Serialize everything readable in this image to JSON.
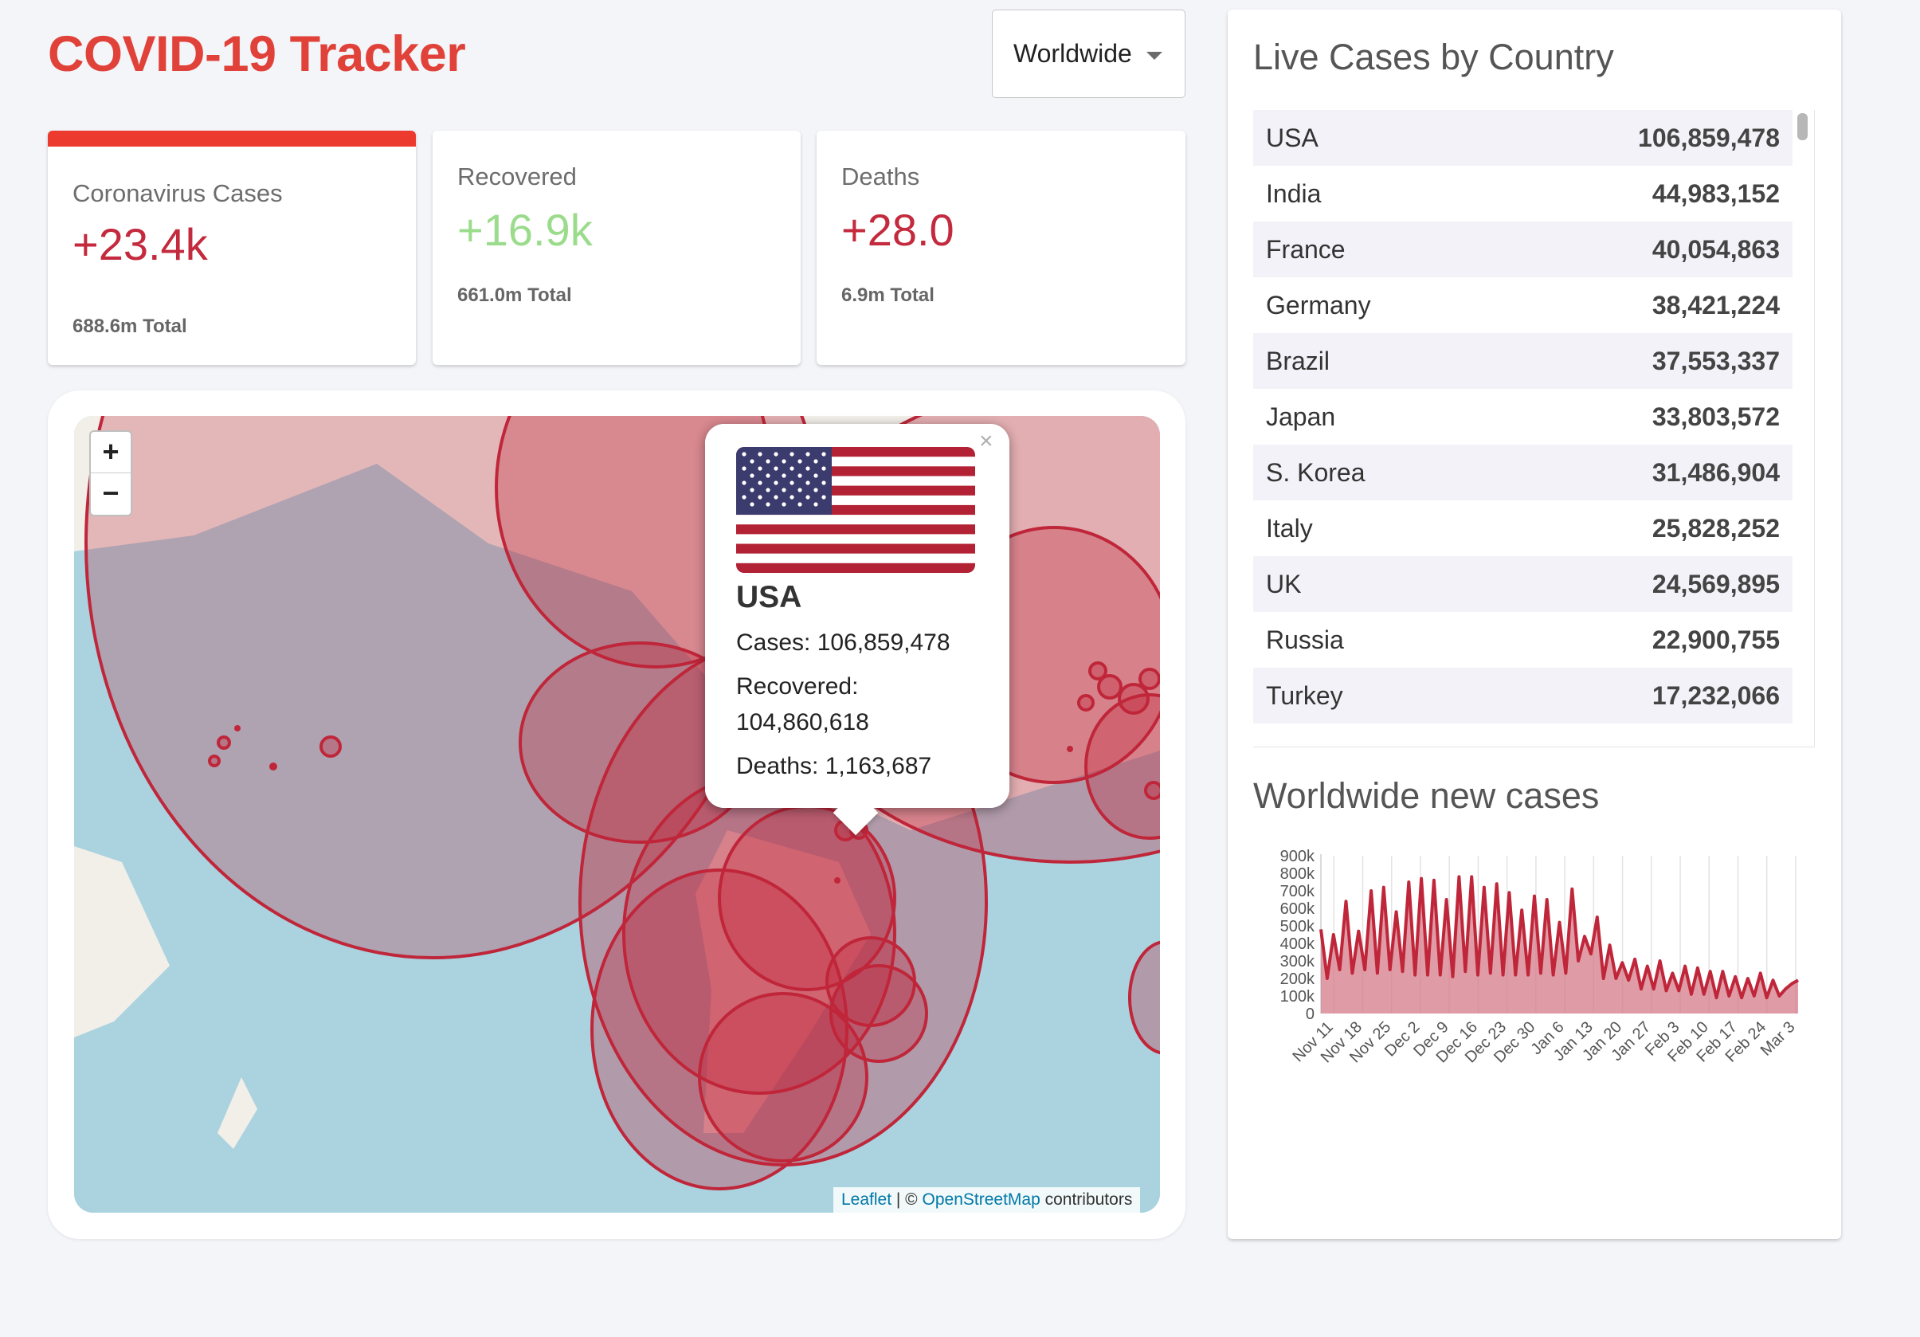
{
  "app": {
    "title": "COVID-19 Tracker"
  },
  "country_select": {
    "selected": "Worldwide"
  },
  "stats": [
    {
      "label": "Coronavirus Cases",
      "value": "+23.4k",
      "total": "688.6m Total"
    },
    {
      "label": "Recovered",
      "value": "+16.9k",
      "total": "661.0m Total"
    },
    {
      "label": "Deaths",
      "value": "+28.0",
      "total": "6.9m Total"
    }
  ],
  "map": {
    "zoom_in": "+",
    "zoom_out": "−",
    "attribution": {
      "leaflet": "Leaflet",
      "separator": " | © ",
      "osm": "OpenStreetMap",
      "contributors": " contributors"
    },
    "popup": {
      "close": "×",
      "country": "USA",
      "cases": "Cases: 106,859,478",
      "recovered_label": "Recovered:",
      "recovered_value": "104,860,618",
      "deaths": "Deaths: 1,163,687"
    }
  },
  "live_cases": {
    "heading": "Live Cases by Country",
    "rows": [
      {
        "country": "USA",
        "cases": "106,859,478"
      },
      {
        "country": "India",
        "cases": "44,983,152"
      },
      {
        "country": "France",
        "cases": "40,054,863"
      },
      {
        "country": "Germany",
        "cases": "38,421,224"
      },
      {
        "country": "Brazil",
        "cases": "37,553,337"
      },
      {
        "country": "Japan",
        "cases": "33,803,572"
      },
      {
        "country": "S. Korea",
        "cases": "31,486,904"
      },
      {
        "country": "Italy",
        "cases": "25,828,252"
      },
      {
        "country": "UK",
        "cases": "24,569,895"
      },
      {
        "country": "Russia",
        "cases": "22,900,755"
      },
      {
        "country": "Turkey",
        "cases": "17,232,066"
      }
    ]
  },
  "new_cases": {
    "heading": "Worldwide new cases"
  },
  "colors": {
    "title": "#e0423a",
    "cases_red": "#c32a3d",
    "recovered_green": "#9bdc8c",
    "line": "#c0263a",
    "area": "#d67b88"
  },
  "chart_data": {
    "type": "area",
    "title": "Worldwide new cases",
    "ylim": [
      0,
      900000
    ],
    "y_ticks": [
      "0",
      "100k",
      "200k",
      "300k",
      "400k",
      "500k",
      "600k",
      "700k",
      "800k",
      "900k"
    ],
    "x_ticks": [
      "Nov 11",
      "Nov 18",
      "Nov 25",
      "Dec 2",
      "Dec 9",
      "Dec 16",
      "Dec 23",
      "Dec 30",
      "Jan 6",
      "Jan 13",
      "Jan 20",
      "Jan 27",
      "Feb 3",
      "Feb 10",
      "Feb 17",
      "Feb 24",
      "Mar 3"
    ],
    "series": [
      {
        "values": [
          480000,
          200000,
          450000,
          250000,
          640000,
          230000,
          470000,
          250000,
          700000,
          230000,
          720000,
          250000,
          580000,
          240000,
          750000,
          220000,
          770000,
          220000,
          760000,
          220000,
          650000,
          210000,
          780000,
          240000,
          780000,
          220000,
          720000,
          230000,
          740000,
          220000,
          690000,
          220000,
          590000,
          220000,
          670000,
          230000,
          650000,
          220000,
          520000,
          230000,
          710000,
          300000,
          440000,
          340000,
          550000,
          200000,
          390000,
          200000,
          290000,
          190000,
          310000,
          140000,
          270000,
          140000,
          300000,
          130000,
          230000,
          130000,
          270000,
          110000,
          260000,
          110000,
          240000,
          90000,
          240000,
          100000,
          210000,
          90000,
          200000,
          100000,
          230000,
          90000,
          190000,
          100000,
          140000,
          170000,
          190000
        ]
      }
    ]
  }
}
